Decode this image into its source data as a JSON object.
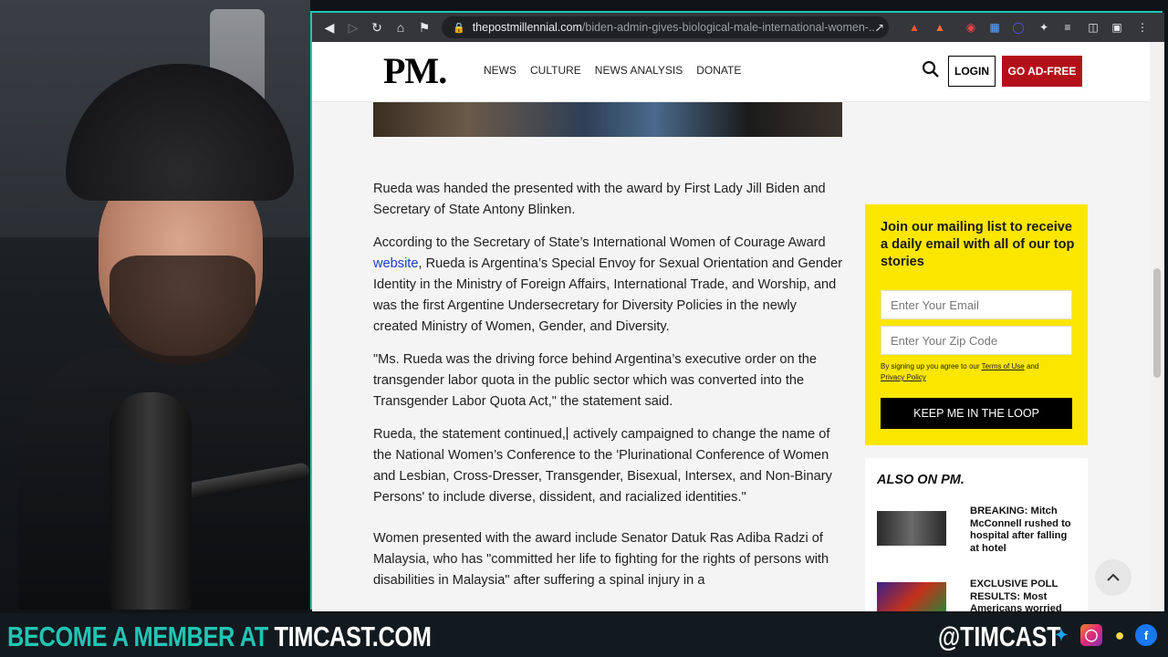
{
  "browser": {
    "url_domain": "thepostmillennial.com",
    "url_path": "/biden-admin-gives-biological-male-international-women-..."
  },
  "site": {
    "logo": "PM.",
    "nav": [
      "NEWS",
      "CULTURE",
      "NEWS ANALYSIS",
      "DONATE"
    ],
    "login": "LOGIN",
    "ad_free": "GO AD-FREE"
  },
  "article": {
    "p1": "Rueda was handed the presented with the award by First Lady Jill Biden and Secretary of State Antony Blinken.",
    "p2_before": "According to the Secretary of State’s International Women of Courage Award ",
    "p2_link": "website",
    "p2_after": ", Rueda is Argentina’s Special Envoy for Sexual Orientation and Gender Identity in the Ministry of Foreign Affairs, International Trade, and Worship, and was the first Argentine Undersecretary for Diversity Policies in the newly created Ministry of Women, Gender, and Diversity.",
    "p3": "\"Ms. Rueda was the driving force behind Argentina’s executive order on the transgender labor quota in the public sector which was converted into the Transgender Labor Quota Act,\" the statement said.",
    "p4_before": "Rueda, the statement continued,",
    "p4_after": "actively campaigned to change the name of the National Women’s Conference to the 'Plurinational Conference of Women and Lesbian, Cross-Dresser, Transgender, Bisexual, Intersex, and Non-Binary Persons' to include diverse, dissident, and racialized identities.\"",
    "p5": "Women presented with the award include Senator Datuk Ras Adiba Radzi of Malaysia, who has \"committed her life to fighting for the rights of persons with disabilities in Malaysia\" after suffering a spinal injury in a"
  },
  "newsletter": {
    "heading": "Join our mailing list to receive a daily email with all of our top stories",
    "email_placeholder": "Enter Your Email",
    "zip_placeholder": "Enter Your Zip Code",
    "terms_before": "By signing up you agree to our ",
    "terms_link": "Terms of Use",
    "terms_mid": " and ",
    "privacy_link": "Privacy Policy",
    "button": "KEEP ME IN THE LOOP"
  },
  "also_on": {
    "heading": "ALSO ON PM.",
    "items": [
      {
        "headline": "BREAKING: Mitch McConnell rushed to hospital after falling at hotel"
      },
      {
        "headline": "EXCLUSIVE POLL RESULTS: Most Americans worried"
      }
    ]
  },
  "banner": {
    "left_prefix": "BECOME A MEMBER AT ",
    "left_site": "TIMCAST.COM",
    "right_handle": "@TIMCAST"
  },
  "colors": {
    "accent_teal": "#22c4b4",
    "ad_free_red": "#b4101a",
    "newsletter_yellow": "#fbe600",
    "link_blue": "#1a3dcc"
  }
}
